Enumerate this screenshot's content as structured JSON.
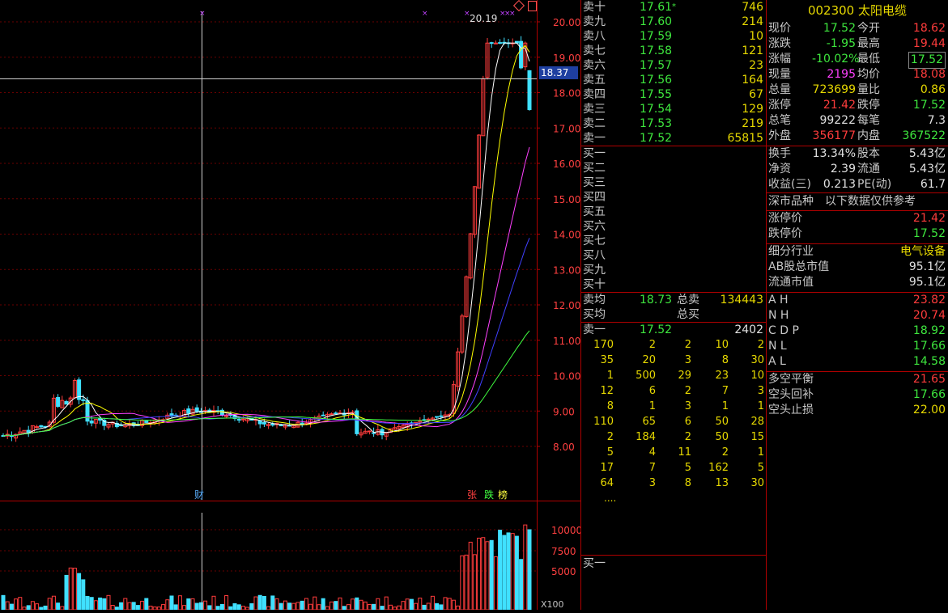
{
  "chart": {
    "price_ticks": [
      "20.00",
      "19.00",
      "18.00",
      "17.00",
      "16.00",
      "15.00",
      "14.00",
      "13.00",
      "12.00",
      "11.00",
      "10.00",
      "9.00",
      "8.00"
    ],
    "high_label": "20.19",
    "cursor_price": "18.37",
    "marker_cai": "财",
    "marker_zhang": "张",
    "marker_die": "跌",
    "marker_bang": "榜",
    "volume_ticks": [
      "10000",
      "7500",
      "5000"
    ],
    "volume_unit": "X100",
    "colors": {
      "up": "#ff3c3c",
      "down": "#40e0ff",
      "ma5": "#ffffff",
      "ma10": "#ffff00",
      "ma20": "#ff40ff",
      "ma30": "#4040ff",
      "ma60": "#40ff40"
    }
  },
  "orderbook": {
    "asks": [
      {
        "label": "卖十",
        "price": "17.61",
        "flag": "*",
        "vol": "746"
      },
      {
        "label": "卖九",
        "price": "17.60",
        "flag": "",
        "vol": "214"
      },
      {
        "label": "卖八",
        "price": "17.59",
        "flag": "",
        "vol": "10"
      },
      {
        "label": "卖七",
        "price": "17.58",
        "flag": "",
        "vol": "121"
      },
      {
        "label": "卖六",
        "price": "17.57",
        "flag": "",
        "vol": "23"
      },
      {
        "label": "卖五",
        "price": "17.56",
        "flag": "",
        "vol": "164"
      },
      {
        "label": "卖四",
        "price": "17.55",
        "flag": "",
        "vol": "67"
      },
      {
        "label": "卖三",
        "price": "17.54",
        "flag": "",
        "vol": "129"
      },
      {
        "label": "卖二",
        "price": "17.53",
        "flag": "",
        "vol": "219"
      },
      {
        "label": "卖一",
        "price": "17.52",
        "flag": "",
        "vol": "65815"
      }
    ],
    "bids": [
      "买一",
      "买二",
      "买三",
      "买四",
      "买五",
      "买六",
      "买七",
      "买八",
      "买九",
      "买十"
    ],
    "sell_avg_label": "卖均",
    "sell_avg": "18.73",
    "total_sell_label": "总卖",
    "total_sell": "134443",
    "buy_avg_label": "买均",
    "total_buy_label": "总买",
    "queue_label": "卖一",
    "queue_price": "17.52",
    "queue_vol": "2402",
    "queue_rows": [
      [
        "170",
        "2",
        "2",
        "10",
        "2"
      ],
      [
        "35",
        "20",
        "3",
        "8",
        "30"
      ],
      [
        "1",
        "500",
        "29",
        "23",
        "10"
      ],
      [
        "12",
        "6",
        "2",
        "7",
        "3"
      ],
      [
        "8",
        "1",
        "3",
        "1",
        "1"
      ],
      [
        "110",
        "65",
        "6",
        "50",
        "28"
      ],
      [
        "2",
        "184",
        "2",
        "50",
        "15"
      ],
      [
        "5",
        "4",
        "11",
        "2",
        "1"
      ],
      [
        "17",
        "7",
        "5",
        "162",
        "5"
      ],
      [
        "64",
        "3",
        "8",
        "13",
        "30"
      ]
    ],
    "queue_more": "....",
    "bottom_label": "买一"
  },
  "quote": {
    "code": "002300",
    "name": "太阳电缆",
    "rows1": [
      {
        "l1": "现价",
        "v1": "17.52",
        "c1": "g",
        "l2": "今开",
        "v2": "18.62",
        "c2": "r"
      },
      {
        "l1": "涨跌",
        "v1": "-1.95",
        "c1": "g",
        "l2": "最高",
        "v2": "19.44",
        "c2": "r"
      },
      {
        "l1": "涨幅",
        "v1": "-10.02%",
        "c1": "g",
        "l2": "最低",
        "v2": "17.52",
        "c2": "g",
        "box": true
      },
      {
        "l1": "现量",
        "v1": "2195",
        "c1": "m",
        "l2": "均价",
        "v2": "18.08",
        "c2": "r"
      },
      {
        "l1": "总量",
        "v1": "723699",
        "c1": "y",
        "l2": "量比",
        "v2": "0.86",
        "c2": "y"
      },
      {
        "l1": "涨停",
        "v1": "21.42",
        "c1": "r",
        "l2": "跌停",
        "v2": "17.52",
        "c2": "g"
      },
      {
        "l1": "总笔",
        "v1": "99222",
        "c1": "w",
        "l2": "每笔",
        "v2": "7.3",
        "c2": "w"
      },
      {
        "l1": "外盘",
        "v1": "356177",
        "c1": "r",
        "l2": "内盘",
        "v2": "367522",
        "c2": "g"
      }
    ],
    "rows2": [
      {
        "l1": "换手",
        "v1": "13.34%",
        "c1": "w",
        "l2": "股本",
        "v2": "5.43亿",
        "c2": "w"
      },
      {
        "l1": "净资",
        "v1": "2.39",
        "c1": "w",
        "l2": "流通",
        "v2": "5.43亿",
        "c2": "w"
      },
      {
        "l1": "收益(三)",
        "v1": "0.213",
        "c1": "w",
        "l2": "PE(动)",
        "v2": "61.7",
        "c2": "w"
      }
    ],
    "market_note_a": "深市品种",
    "market_note_b": "以下数据仅供参考",
    "limit_up_label": "涨停价",
    "limit_up": "21.42",
    "limit_down_label": "跌停价",
    "limit_down": "17.52",
    "industry_label": "细分行业",
    "industry": "电气设备",
    "ab_cap_label": "AB股总市值",
    "ab_cap": "95.1亿",
    "float_cap_label": "流通市值",
    "float_cap": "95.1亿",
    "indicators": [
      {
        "l": "A H",
        "v": "23.82",
        "c": "r"
      },
      {
        "l": "N H",
        "v": "20.74",
        "c": "r"
      },
      {
        "l": "C D P",
        "v": "18.92",
        "c": "g"
      },
      {
        "l": "N L",
        "v": "17.66",
        "c": "g"
      },
      {
        "l": "A L",
        "v": "14.58",
        "c": "g"
      }
    ],
    "signals": [
      {
        "l": "多空平衡",
        "v": "21.65",
        "c": "r"
      },
      {
        "l": "空头回补",
        "v": "17.66",
        "c": "g"
      },
      {
        "l": "空头止损",
        "v": "22.00",
        "c": "y"
      }
    ]
  }
}
